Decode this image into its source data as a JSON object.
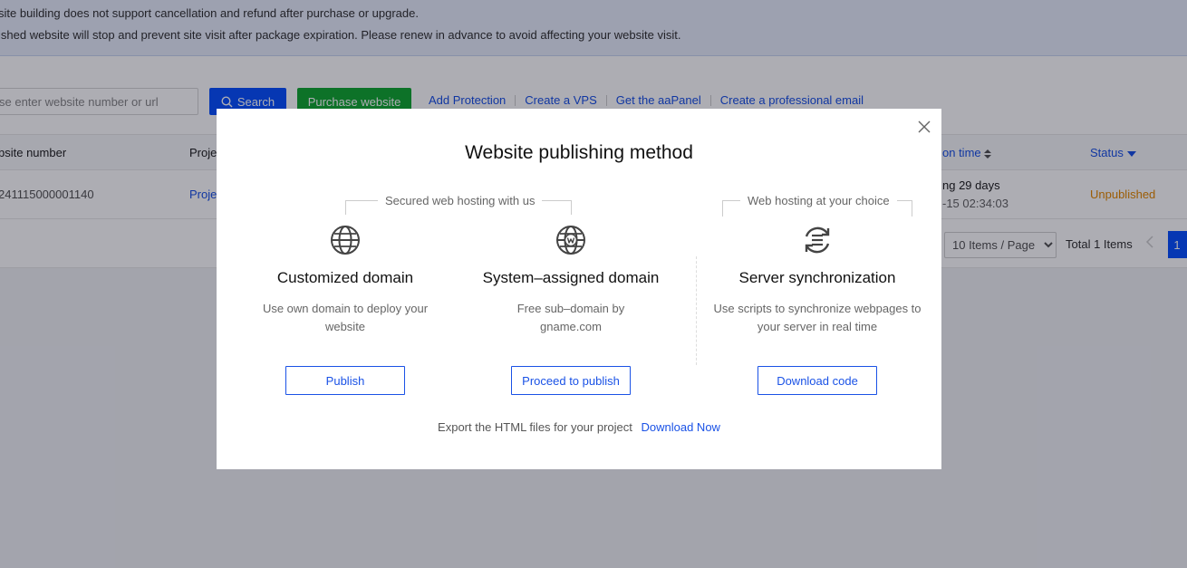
{
  "notice": {
    "line1": "site building does not support cancellation and refund after purchase or upgrade.",
    "line2": "ished website will stop and prevent site visit after package expiration. Please renew in advance to avoid affecting your website visit."
  },
  "toolbar": {
    "search_placeholder": "se enter website number or url",
    "search_label": "Search",
    "purchase_label": "Purchase website",
    "links": [
      "Add Protection",
      "Create a VPS",
      "Get the aaPanel",
      "Create a professional email"
    ]
  },
  "table": {
    "headers": {
      "website_number": "bsite number",
      "project": "Proje",
      "expiration": "on time",
      "status": "Status"
    },
    "rows": [
      {
        "website_number": "241115000001140",
        "project": "Proje",
        "expiration_line1": "ng 29 days",
        "expiration_line2": "-15 02:34:03",
        "status": "Unpublished"
      }
    ]
  },
  "pagination": {
    "page_size": "10 Items / Page",
    "page_size_options": [
      "10 Items / Page"
    ],
    "total": "Total 1 Items",
    "current_page": "1"
  },
  "modal": {
    "title": "Website publishing method",
    "group_left": "Secured web hosting with us",
    "group_right": "Web hosting at your choice",
    "options": [
      {
        "icon": "globe-icon",
        "title": "Customized domain",
        "description": "Use own domain to deploy your website",
        "button": "Publish"
      },
      {
        "icon": "globe-w-icon",
        "title": "System–assigned domain",
        "description": "Free sub–domain by gname.com",
        "button": "Proceed to publish"
      },
      {
        "icon": "sync-icon",
        "title": "Server synchronization",
        "description": "Use scripts to synchronize webpages to your server in real time",
        "button": "Download code"
      }
    ],
    "export_text": "Export the HTML files for your project",
    "export_link": "Download Now"
  },
  "colors": {
    "primary": "#1a52e6",
    "search_button": "#0a52ff",
    "purchase_button": "#14a833",
    "status_unpublished": "#e68a00"
  }
}
